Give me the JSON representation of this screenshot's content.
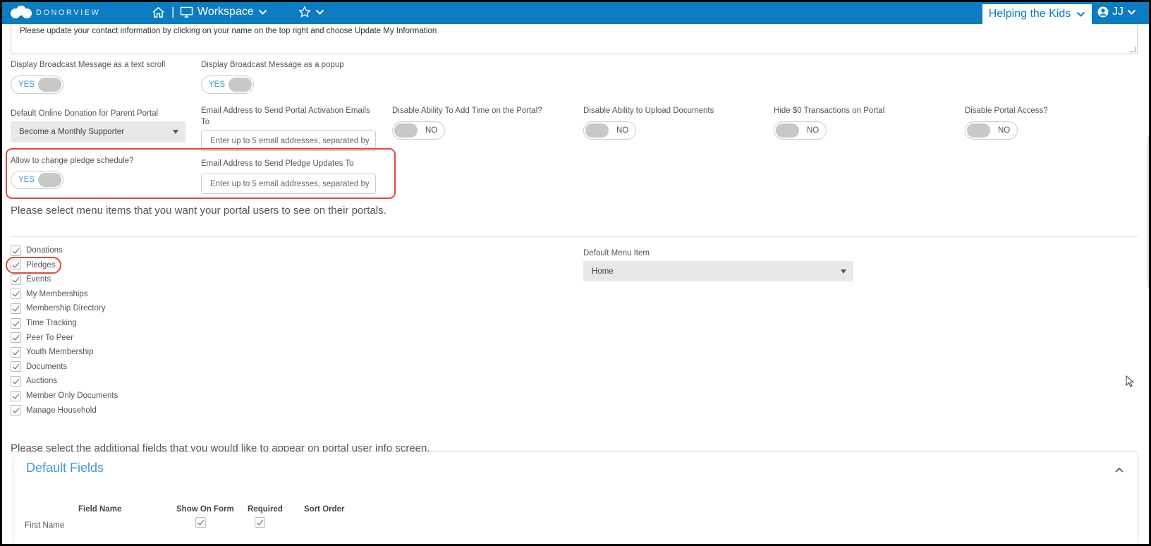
{
  "nav": {
    "brand": "DONORVIEW",
    "separator": "|",
    "workspace_label": "Workspace",
    "org_label": "Helping the Kids",
    "user_initials": "JJ"
  },
  "broadcast": {
    "message": "Please update your contact information by clicking on your name on the top right and choose Update My Information",
    "text_scroll_label": "Display Broadcast Message as a text scroll",
    "text_scroll_value": "YES",
    "popup_label": "Display Broadcast Message as a popup",
    "popup_value": "YES"
  },
  "settings": {
    "default_donation_label": "Default Online Donation for Parent Portal",
    "default_donation_value": "Become a Monthly Supporter",
    "activation_email_label": "Email Address to Send Portal Activation Emails To",
    "activation_email_placeholder": "Enter up to 5 email addresses, separated by",
    "disable_add_time_label": "Disable Ability To Add Time on the Portal?",
    "disable_add_time_value": "NO",
    "disable_upload_label": "Disable Ability to Upload Documents",
    "disable_upload_value": "NO",
    "hide_zero_label": "Hide $0 Transactions on Portal",
    "hide_zero_value": "NO",
    "disable_access_label": "Disable Portal Access?",
    "disable_access_value": "NO",
    "pledge_schedule_label": "Allow to change pledge schedule?",
    "pledge_schedule_value": "YES",
    "pledge_email_label": "Email Address to Send Pledge Updates To",
    "pledge_email_placeholder": "Enter up to 5 email addresses, separated by"
  },
  "menu_section": {
    "heading": "Please select menu items that you want your portal users to see on their portals.",
    "items": [
      "Donations",
      "Pledges",
      "Events",
      "My Memberships",
      "Membership Directory",
      "Time Tracking",
      "Peer To Peer",
      "Youth Membership",
      "Documents",
      "Auctions",
      "Member Only Documents",
      "Manage Household"
    ],
    "default_menu_label": "Default Menu Item",
    "default_menu_value": "Home"
  },
  "fields_section": {
    "heading": "Please select the additional fields that you would like to appear on portal user info screen.",
    "panel_title": "Default Fields",
    "columns": [
      "Field Name",
      "Show On Form",
      "Required",
      "Sort Order"
    ],
    "first_row_name": "First Name"
  },
  "colors": {
    "nav_blue": "#0b7cc1",
    "accent_blue": "#3a9ad9",
    "highlight_red": "#e0483a"
  }
}
